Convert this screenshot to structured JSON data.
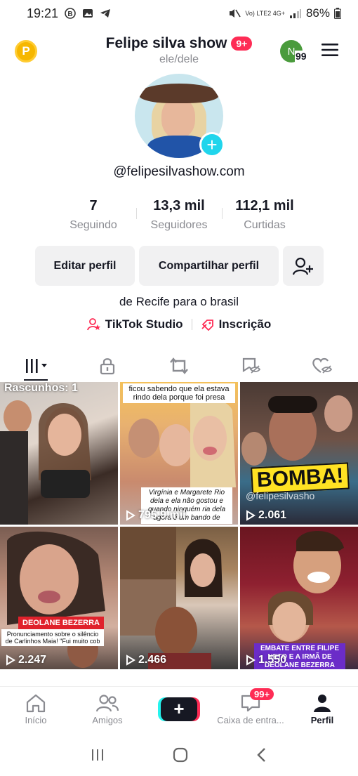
{
  "status_bar": {
    "time": "19:21",
    "battery": "86%",
    "network": "Vo) LTE2 4G+"
  },
  "header": {
    "title": "Felipe silva show",
    "badge": "9+",
    "pronouns": "ele/dele",
    "coin_letter": "P",
    "avatar_letter": "N",
    "avatar_count": "99"
  },
  "profile": {
    "username": "@felipesilvashow.com",
    "stats": [
      {
        "value": "7",
        "label": "Seguindo"
      },
      {
        "value": "13,3 mil",
        "label": "Seguidores"
      },
      {
        "value": "112,1 mil",
        "label": "Curtidas"
      }
    ],
    "edit_label": "Editar perfil",
    "share_label": "Compartilhar perfil",
    "bio": "de Recife para o brasil",
    "link_studio": "TikTok Studio",
    "link_inscricao": "Inscrição"
  },
  "tabs": [
    {
      "icon": "grid-icon",
      "active": true
    },
    {
      "icon": "lock-icon"
    },
    {
      "icon": "repost-icon"
    },
    {
      "icon": "hidden-tag-icon"
    },
    {
      "icon": "hidden-heart-icon"
    }
  ],
  "videos": [
    {
      "overlay": "Rascunhos: 1",
      "views": ""
    },
    {
      "views": "795,9 mil",
      "caption_top": "ficou sabendo que ela estava rindo dela porque foi presa",
      "caption_mid": "Virgínia e Margarete Rio dela e ela não gostou e quando ninguém ria dela agora é um bando de"
    },
    {
      "views": "2.061",
      "bomba": "BOMBA!",
      "handle": "@felipesilvasho"
    },
    {
      "views": "2.247",
      "red_label": "DEOLANE BEZERRA",
      "white_cap": "Pronunciamento sobre o silêncio de Carlinhos Maia! \"Fui muito cob"
    },
    {
      "views": "2.466"
    },
    {
      "views": "1.550",
      "purple": "EMBATE ENTRE FILIPE NETO E A IRMÃ DE DEOLANE BEZERRA"
    }
  ],
  "bottom_nav": {
    "home": "Início",
    "friends": "Amigos",
    "inbox": "Caixa de entra...",
    "inbox_badge": "99+",
    "profile": "Perfil",
    "create": "+"
  },
  "colors": {
    "accent": "#fe2c55",
    "cyan": "#20d5ec",
    "text": "#161823",
    "muted": "#8a8b91"
  }
}
